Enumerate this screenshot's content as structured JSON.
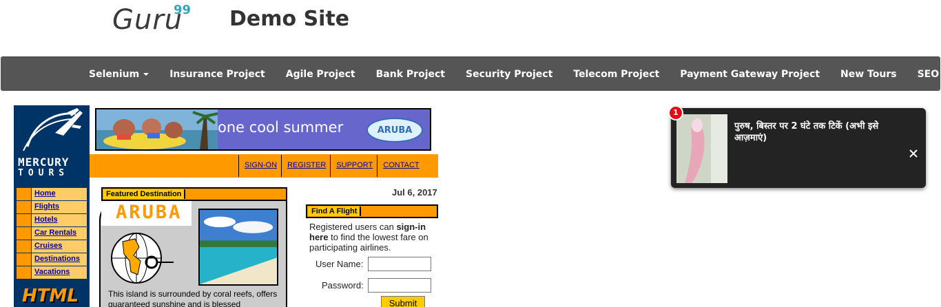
{
  "header": {
    "logo_text": "Guru",
    "logo_sup": "99",
    "site_title": "Demo Site"
  },
  "navbar": {
    "items": [
      {
        "label": "Selenium",
        "dropdown": true
      },
      {
        "label": "Insurance Project",
        "dropdown": false
      },
      {
        "label": "Agile Project",
        "dropdown": false
      },
      {
        "label": "Bank Project",
        "dropdown": false
      },
      {
        "label": "Security Project",
        "dropdown": false
      },
      {
        "label": "Telecom Project",
        "dropdown": false
      },
      {
        "label": "Payment Gateway Project",
        "dropdown": false
      },
      {
        "label": "New Tours",
        "dropdown": false
      },
      {
        "label": "SEO",
        "dropdown": true
      }
    ]
  },
  "mercury": {
    "brand_line1": "MERCURY",
    "brand_line2": "TOURS",
    "banner_text": "one cool summer",
    "banner_logo": "ARUBA",
    "top_links": [
      "SIGN-ON",
      "REGISTER",
      "SUPPORT",
      "CONTACT"
    ],
    "side_menu": [
      "Home",
      "Flights",
      "Hotels",
      "Car Rentals",
      "Cruises",
      "Destinations",
      "Vacations"
    ],
    "html_badge": "HTML",
    "featured_label": "Featured Destination",
    "featured_title": "ARUBA",
    "featured_text": "This island is surrounded by coral reefs, offers guaranteed sunshine and is blessed",
    "date": "Jul 6, 2017",
    "find_flight_label": "Find A Flight",
    "find_flight_intro_pre": "Registered users can ",
    "find_flight_intro_bold1": "sign-in",
    "find_flight_intro_bold2": "here",
    "find_flight_intro_post": " to find the lowest fare on participating airlines.",
    "username_label": "User Name:",
    "username_value": "",
    "password_label": "Password:",
    "password_value": "",
    "submit_label": "Submit"
  },
  "notification": {
    "badge_count": "1",
    "text": "पुरुष, बिस्तर पर 2 घंटे तक टिकें (अभी इसे आज़माएं)",
    "close_icon": "close-icon"
  },
  "colors": {
    "navbar_bg": "#555555",
    "mercury_navy": "#003366",
    "mercury_orange": "#ff9900",
    "mercury_yellow": "#ffcc00",
    "notif_bg": "#232323",
    "badge_red": "#e50914"
  }
}
